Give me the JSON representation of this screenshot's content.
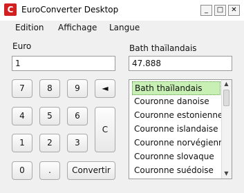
{
  "window": {
    "title": "EuroConverter Desktop",
    "icon_letter": "C",
    "controls": {
      "minimize": "_",
      "maximize": "□",
      "close": "✕"
    }
  },
  "menu": [
    "Edition",
    "Affichage",
    "Langue"
  ],
  "left": {
    "label": "Euro",
    "value": "1"
  },
  "right": {
    "label": "Bath thaïlandais",
    "value": "47.888"
  },
  "keypad": {
    "row1": [
      "7",
      "8",
      "9",
      "◄"
    ],
    "row2": [
      "4",
      "5",
      "6"
    ],
    "row3": [
      "1",
      "2",
      "3"
    ],
    "row4": [
      "0",
      "."
    ],
    "clear": "C",
    "convert": "Convertir"
  },
  "currencies": {
    "items": [
      "Bath thaïlandais",
      "Couronne danoise",
      "Couronne estonienne",
      "Couronne islandaise",
      "Couronne norvégienne",
      "Couronne slovaque",
      "Couronne suédoise"
    ],
    "selected": "Bath thaïlandais"
  },
  "colors": {
    "selection": "#c8f0b4",
    "app_icon": "#d21f1f"
  },
  "icons": {
    "app": "converter-logo-icon",
    "scroll_up": "scroll-up-arrow-icon",
    "scroll_down": "scroll-down-arrow-icon"
  }
}
